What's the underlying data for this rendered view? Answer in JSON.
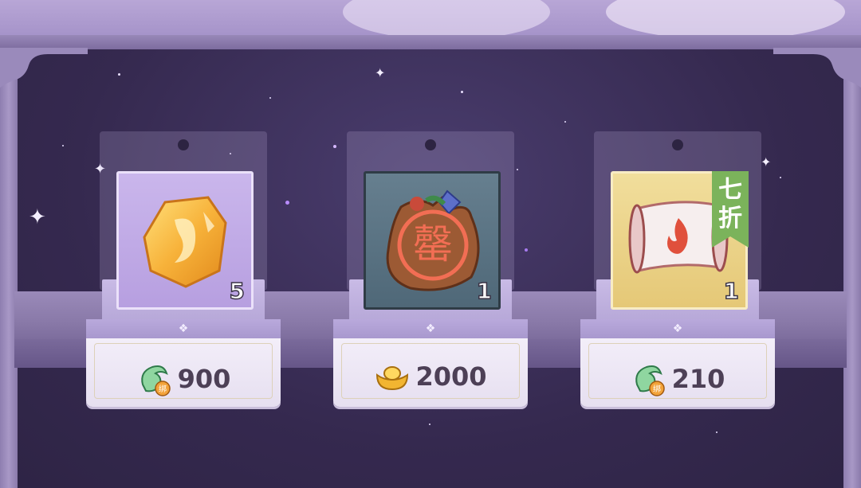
{
  "shop": {
    "items": [
      {
        "name": "amber-crystal",
        "quantity": "5",
        "price": "900",
        "currency": "bound-jade-coin-icon",
        "frame": "purple"
      },
      {
        "name": "loot-bag",
        "quantity": "1",
        "price": "2000",
        "currency": "gold-ingot-icon",
        "frame": "teal",
        "seal_text": "罄"
      },
      {
        "name": "fire-scroll",
        "quantity": "1",
        "price": "210",
        "currency": "bound-jade-coin-icon",
        "frame": "gold",
        "badge": "七折"
      }
    ]
  },
  "currency_tag": "绑",
  "colors": {
    "shelf": "#8a7aa9",
    "backdrop": "#35294f",
    "badge_green": "#7bb35b",
    "price_text": "#4d4056"
  }
}
